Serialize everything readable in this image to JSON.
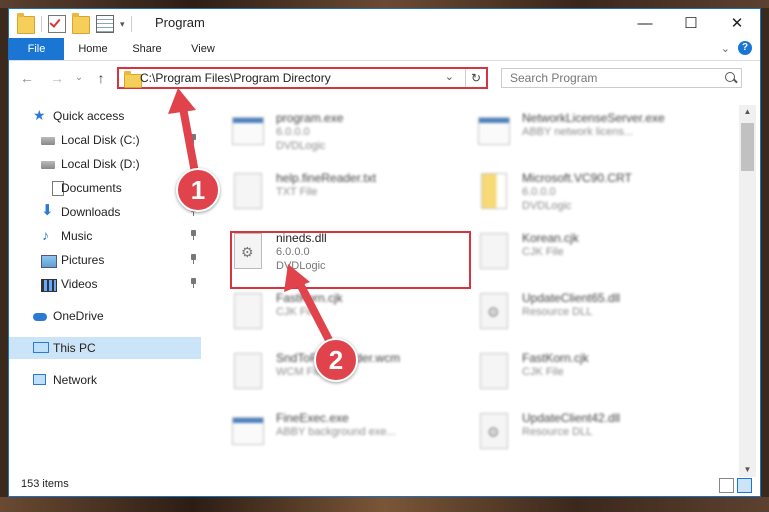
{
  "window": {
    "title": "Program",
    "controls": {
      "minimize": "—",
      "maximize": "☐",
      "close": "✕"
    }
  },
  "ribbon": {
    "tabs": [
      "File",
      "Home",
      "Share",
      "View"
    ]
  },
  "nav": {
    "back": "←",
    "forward": "→",
    "recent": "⌄",
    "up": "↑"
  },
  "address": {
    "path": "C:\\Program Files\\Program Directory",
    "dropdown": "⌄",
    "refresh": "↻"
  },
  "search": {
    "placeholder": "Search Program"
  },
  "sidebar": {
    "items": [
      {
        "label": "Quick access",
        "icon": "star-icon"
      },
      {
        "label": "Local Disk (C:)",
        "icon": "drive-icon"
      },
      {
        "label": "Local Disk (D:)",
        "icon": "drive-icon"
      },
      {
        "label": "Documents",
        "icon": "documents-icon"
      },
      {
        "label": "Downloads",
        "icon": "downloads-icon"
      },
      {
        "label": "Music",
        "icon": "music-icon"
      },
      {
        "label": "Pictures",
        "icon": "pictures-icon"
      },
      {
        "label": "Videos",
        "icon": "videos-icon"
      },
      {
        "label": "OneDrive",
        "icon": "onedrive-icon"
      },
      {
        "label": "This PC",
        "icon": "this-pc-icon"
      },
      {
        "label": "Network",
        "icon": "network-icon"
      }
    ]
  },
  "files": [
    {
      "name": "program.exe",
      "line1": "6.0.0.0",
      "line2": "DVDLogic",
      "icon": "exe-icon"
    },
    {
      "name": "NetworkLicenseServer.exe",
      "line1": "ABBY network licens...",
      "line2": "",
      "icon": "exe-icon"
    },
    {
      "name": "help.fineReader.txt",
      "line1": "TXT File",
      "line2": "",
      "icon": "text-file-icon"
    },
    {
      "name": "Microsoft.VC90.CRT",
      "line1": "6.0.0.0",
      "line2": "DVDLogic",
      "icon": "zip-folder-icon"
    },
    {
      "name": "nineds.dll",
      "line1": "6.0.0.0",
      "line2": "DVDLogic",
      "icon": "dll-gear-icon"
    },
    {
      "name": "Korean.cjk",
      "line1": "CJK File",
      "line2": "",
      "icon": "file-icon"
    },
    {
      "name": "FastKorn.cjk",
      "line1": "CJK File",
      "line2": "",
      "icon": "file-icon"
    },
    {
      "name": "UpdateClient65.dll",
      "line1": "Resource DLL",
      "line2": "",
      "icon": "dll-gear-icon"
    },
    {
      "name": "SndToFineReader.wcm",
      "line1": "WCM File",
      "line2": "",
      "icon": "file-icon"
    },
    {
      "name": "FastKorn.cjk",
      "line1": "CJK File",
      "line2": "",
      "icon": "file-icon"
    },
    {
      "name": "FineExec.exe",
      "line1": "ABBY background exe...",
      "line2": "",
      "icon": "exe-icon"
    },
    {
      "name": "UpdateClient42.dll",
      "line1": "Resource DLL",
      "line2": "",
      "icon": "dll-gear-icon"
    }
  ],
  "status": {
    "count": "153 items"
  },
  "annotations": {
    "step1": "1",
    "step2": "2",
    "color": "#e0434b"
  }
}
